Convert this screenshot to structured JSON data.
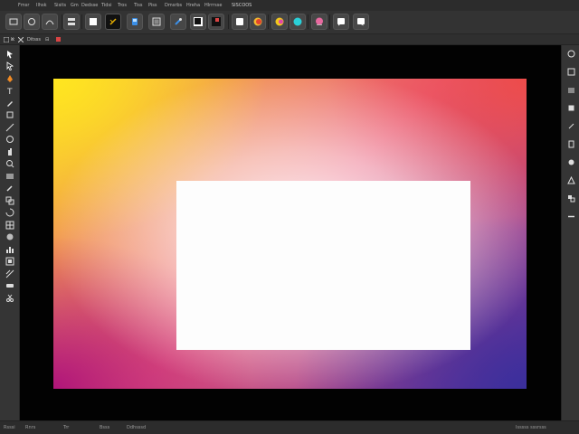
{
  "menubar": {
    "items": [
      "Fmsr",
      "Ilhsk",
      "Sisits",
      "Gm",
      "Dedsse",
      "Tidsi",
      "Tros",
      "Tiss",
      "Piss",
      "Dmsrbs",
      "Hreha",
      "Hlrrrsse"
    ],
    "app_label": "SISCOOS"
  },
  "optionsbar": {
    "tools": [
      {
        "name": "select-frame-icon",
        "color": "#e0e0e0"
      },
      {
        "name": "rotate-icon",
        "color": "#e0e0e0"
      },
      {
        "name": "curve-icon",
        "color": "#e0e0e0"
      },
      {
        "name": "panel-icon",
        "color": "#e0e0e0"
      },
      {
        "name": "blank-swatch-icon",
        "color": "#ffffff"
      },
      {
        "name": "brush-swatch-icon",
        "color": "#e8b000"
      },
      {
        "name": "cube-icon",
        "color": "#3a8ee6"
      },
      {
        "name": "image-icon",
        "color": "#e0e0e0"
      },
      {
        "name": "picker-icon",
        "color": "#3a8ee6"
      },
      {
        "name": "fill-swatch-icon",
        "color": "#111111"
      },
      {
        "name": "stroke-swatch-icon",
        "color": "#d94444"
      },
      {
        "name": "rectangle-icon",
        "color": "#ffffff"
      },
      {
        "name": "gradient-swatch-yellow-icon",
        "color": "#f5b82e"
      },
      {
        "name": "gradient-swatch-orange-icon",
        "color": "#f2c81c"
      },
      {
        "name": "gradient-swatch-cyan-icon",
        "color": "#2ad0d8"
      },
      {
        "name": "gradient-swatch-pink-icon",
        "color": "#e86aa0"
      },
      {
        "name": "speech-bubble-icon",
        "color": "#ffffff"
      },
      {
        "name": "speech-bubble-alt-icon",
        "color": "#ffffff"
      }
    ]
  },
  "tabbar": {
    "document_tab": "Ditsss",
    "extra_marks": [
      "ℵ",
      "⊟"
    ]
  },
  "toolbox": {
    "tools": [
      "selection-icon",
      "direct-selection-icon",
      "pen-icon",
      "type-icon",
      "pencil-icon",
      "shape-icon",
      "line-icon",
      "ellipse-icon",
      "hand-icon",
      "zoom-icon",
      "gradient-icon",
      "eyedropper-icon",
      "scale-icon",
      "rotate-tool-icon",
      "mesh-icon",
      "symbol-icon",
      "chart-tool-icon",
      "artboard-icon",
      "slice-icon",
      "eraser-icon",
      "scissors-icon"
    ]
  },
  "rightpanel": {
    "tools": [
      "color-panel-icon",
      "swatches-panel-icon",
      "layers-panel-icon",
      "properties-panel-icon",
      "links-panel-icon",
      "styles-panel-icon",
      "align-panel-icon",
      "transform-panel-icon",
      "pathfinder-panel-icon",
      "stroke-panel-icon"
    ]
  },
  "colors": {
    "artwork_yellow": "#ffe620",
    "artwork_red": "#ee4c4a",
    "artwork_magenta": "#b0157a",
    "artwork_indigo": "#3a2f9c",
    "frame_fill": "#fdfdfd"
  },
  "statusbar": {
    "left": "Rsssi",
    "items": [
      "Rnrs",
      "Trr",
      "Bsss",
      "Ddhsssd"
    ],
    "right": "Isssss sssrsss"
  }
}
